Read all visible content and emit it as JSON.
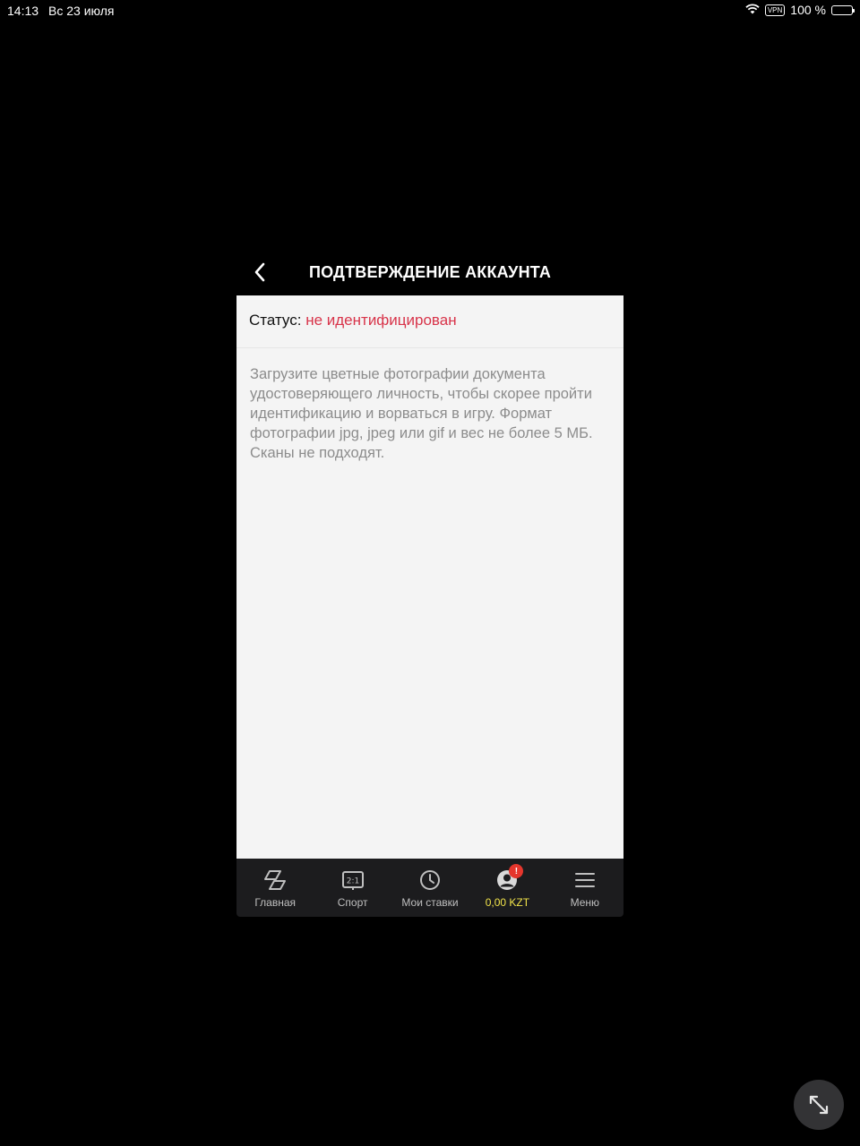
{
  "statusbar": {
    "time": "14:13",
    "date": "Вс 23 июля",
    "vpn": "VPN",
    "battery_percent": "100 %"
  },
  "header": {
    "title": "ПОДТВЕРЖДЕНИЕ АККАУНТА",
    "back_icon": "chevron-left-icon"
  },
  "status": {
    "label": "Статус:",
    "value": "не идентифицирован",
    "value_color": "#d8344a"
  },
  "description": "Загрузите цветные фотографии документа удостоверяющего личность, чтобы скорее пройти идентификацию и ворваться в игру. Формат фотографии jpg, jpeg или gif и вес не более 5 МБ. Сканы не подходят.",
  "tabbar": {
    "items": [
      {
        "label": "Главная",
        "icon": "home-icon"
      },
      {
        "label": "Спорт",
        "icon": "scoreboard-icon"
      },
      {
        "label": "Мои ставки",
        "icon": "clock-icon"
      },
      {
        "label": "0,00 KZT",
        "icon": "account-icon",
        "badge": "!",
        "accent": "#f2e44a"
      },
      {
        "label": "Меню",
        "icon": "menu-icon"
      }
    ]
  },
  "fab_icon": "resize-icon"
}
